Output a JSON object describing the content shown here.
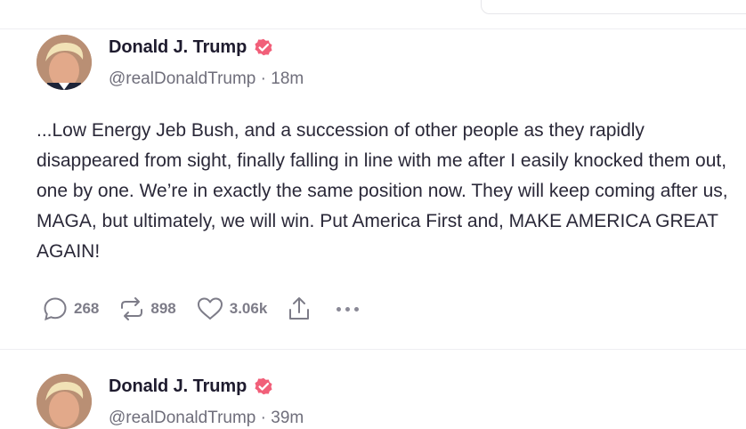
{
  "colors": {
    "verified": "#f15f79",
    "text": "#2a2838",
    "muted": "#7d7c88"
  },
  "posts": [
    {
      "author": "Donald J. Trump",
      "handle": "@realDonaldTrump",
      "separator": "·",
      "time": "18m",
      "text": "...Low Energy Jeb Bush, and a succession of other people as they rapidly disappeared from sight, finally falling in line with me after I easily knocked them out, one by one. We’re in exactly the same position now. They will keep coming after us, MAGA, but ultimately, we will win. Put America First and, MAKE AMERICA GREAT AGAIN!",
      "replies": "268",
      "reposts": "898",
      "likes": "3.06k"
    },
    {
      "author": "Donald J. Trump",
      "handle": "@realDonaldTrump",
      "separator": "·",
      "time": "39m"
    }
  ],
  "icons": {
    "verified": "verified-badge-icon",
    "reply": "speech-bubble-icon",
    "repost": "repost-arrows-icon",
    "like": "heart-icon",
    "share": "share-upload-icon",
    "more": "more-dots-icon"
  }
}
